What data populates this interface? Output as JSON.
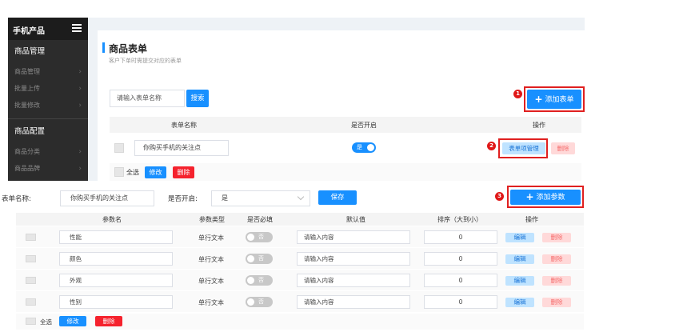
{
  "sidebar": {
    "title": "手机产品",
    "sections": [
      {
        "label": "商品管理",
        "items": [
          "商品管理",
          "批量上传",
          "批量修改"
        ]
      },
      {
        "label": "商品配置",
        "items": [
          "商品分类",
          "商品品牌"
        ]
      }
    ]
  },
  "header": {
    "title": "商品表单",
    "subtitle": "客户下单时需提交对应的表单"
  },
  "form_list": {
    "search_placeholder": "请输入表单名称",
    "search_button": "搜索",
    "add_button": "添加表单",
    "columns": [
      "表单名称",
      "是否开启",
      "操作"
    ],
    "row": {
      "name": "你购买手机的关注点",
      "switch_label": "是",
      "manage_button": "表单项管理",
      "delete_button": "删除"
    },
    "footer": {
      "select_all": "全选",
      "edit_button": "修改",
      "delete_button": "删除"
    }
  },
  "badges": [
    "1",
    "2",
    "3"
  ],
  "form_editor": {
    "name_label": "表单名称:",
    "name_value": "你购买手机的关注点",
    "enabled_label": "是否开启:",
    "enabled_value": "是",
    "save_button": "保存",
    "add_param_button": "添加参数",
    "columns": [
      "参数名",
      "参数类型",
      "是否必填",
      "默认值",
      "排序（大到小）",
      "操作"
    ],
    "rows": [
      {
        "name": "性能",
        "type": "单行文本",
        "required": "否",
        "default_placeholder": "请输入内容",
        "order": "0",
        "edit": "编辑",
        "delete": "删除"
      },
      {
        "name": "颜色",
        "type": "单行文本",
        "required": "否",
        "default_placeholder": "请输入内容",
        "order": "0",
        "edit": "编辑",
        "delete": "删除"
      },
      {
        "name": "外观",
        "type": "单行文本",
        "required": "否",
        "default_placeholder": "请输入内容",
        "order": "0",
        "edit": "编辑",
        "delete": "删除"
      },
      {
        "name": "性别",
        "type": "单行文本",
        "required": "否",
        "default_placeholder": "请输入内容",
        "order": "0",
        "edit": "编辑",
        "delete": "删除"
      }
    ],
    "footer": {
      "select_all": "全选",
      "edit_button": "修改",
      "delete_button": "删除"
    }
  },
  "colors": {
    "primary": "#1890ff",
    "danger": "#f5222d",
    "sidebar": "#2c2c2c",
    "highlight": "#e02020"
  }
}
